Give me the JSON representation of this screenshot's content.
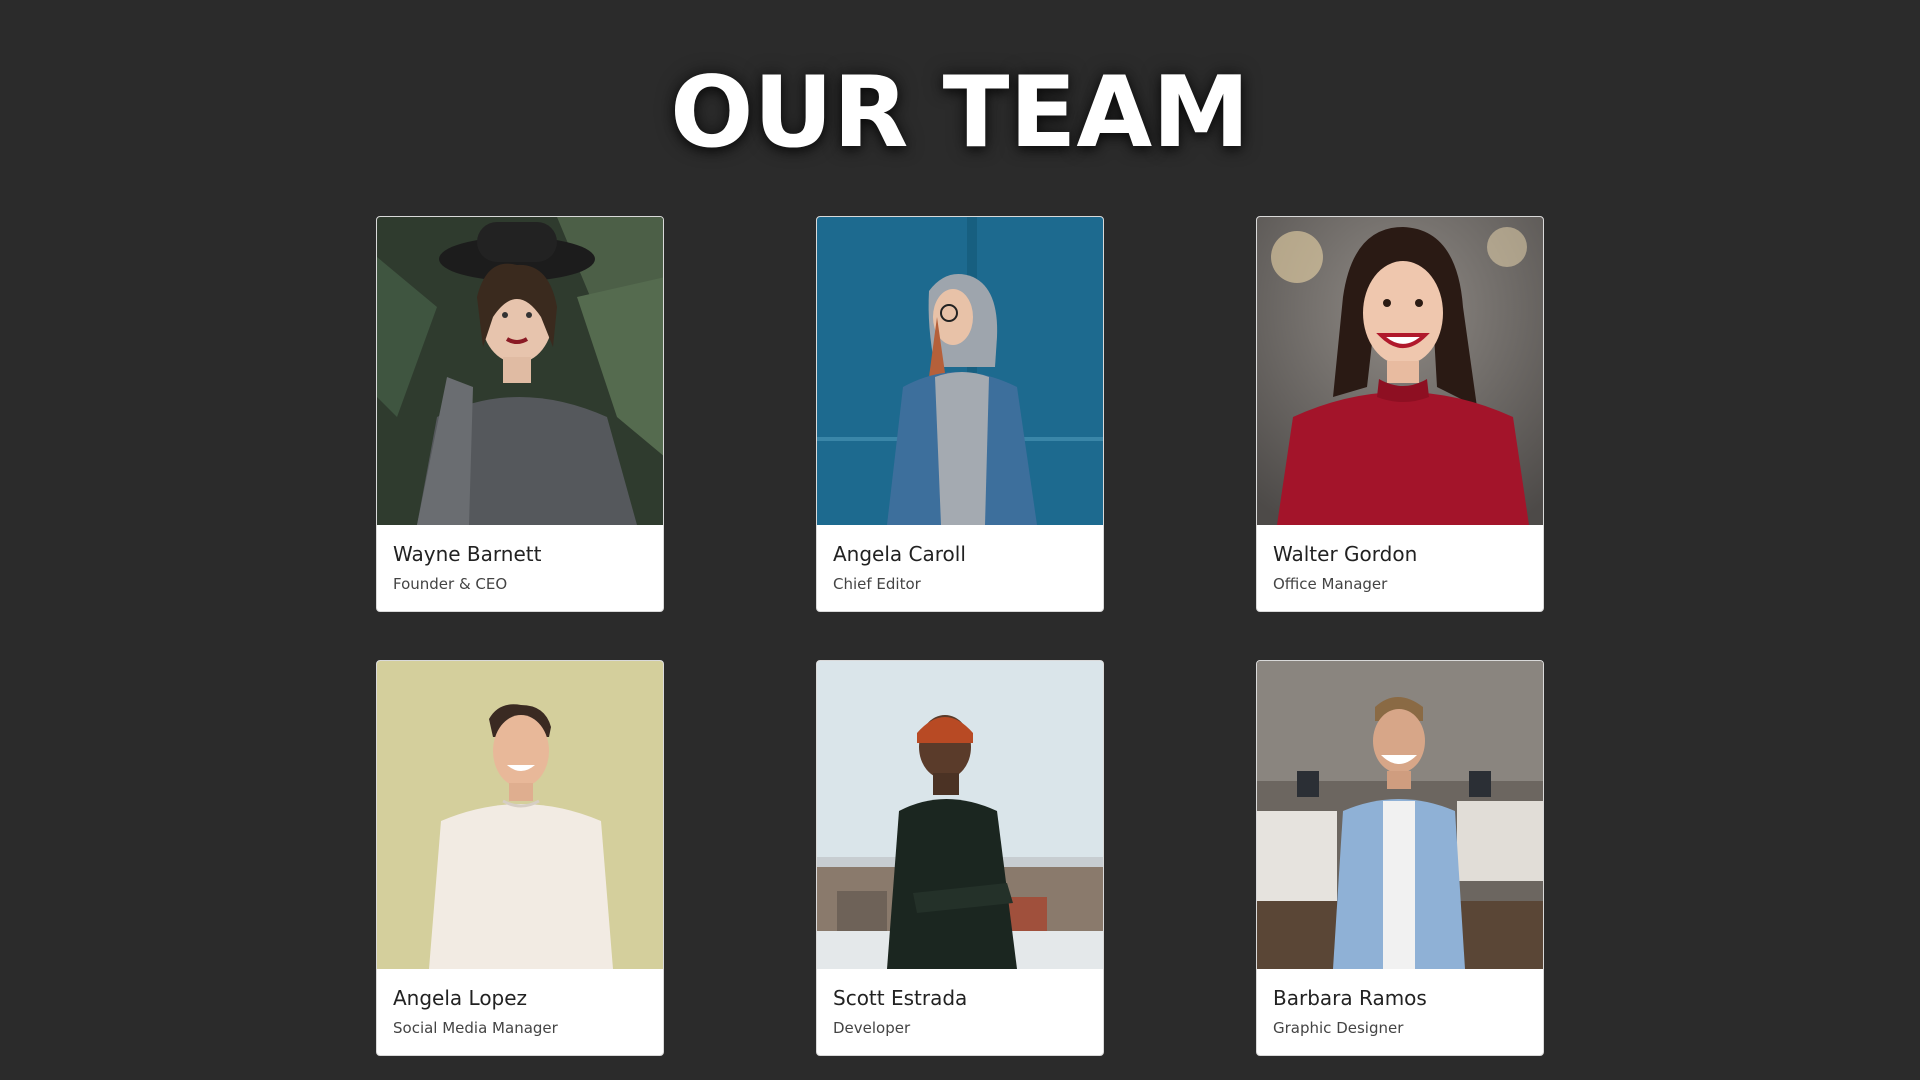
{
  "header": {
    "title": "OUR TEAM"
  },
  "team": [
    {
      "name": "Wayne Barnett",
      "role": "Founder & CEO",
      "photo_icon": "person-photo",
      "bg": "#3d4a3a",
      "accent": "#5a5f63"
    },
    {
      "name": "Angela Caroll",
      "role": "Chief Editor",
      "photo_icon": "person-photo",
      "bg": "#1f6f96",
      "accent": "#3b6f9e"
    },
    {
      "name": "Walter Gordon",
      "role": "Office Manager",
      "photo_icon": "person-photo",
      "bg": "#6d6a68",
      "accent": "#a3142a"
    },
    {
      "name": "Angela Lopez",
      "role": "Social Media Manager",
      "photo_icon": "person-photo",
      "bg": "#d3cf9b",
      "accent": "#efe6de"
    },
    {
      "name": "Scott Estrada",
      "role": "Developer",
      "photo_icon": "person-photo",
      "bg": "#d9e4e8",
      "accent": "#1a2620"
    },
    {
      "name": "Barbara Ramos",
      "role": "Graphic Designer",
      "photo_icon": "person-photo",
      "bg": "#5c5650",
      "accent": "#8fb1d6"
    }
  ]
}
